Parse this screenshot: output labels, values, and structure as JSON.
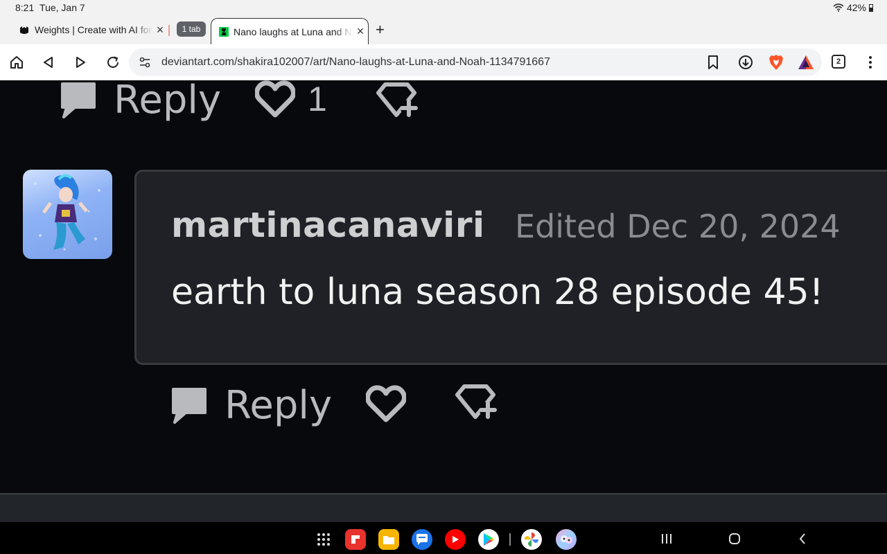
{
  "status_bar": {
    "time": "8:21",
    "date": "Tue, Jan 7",
    "battery": "42%",
    "icons": [
      "wifi-icon",
      "battery-icon"
    ]
  },
  "tabs": {
    "inactive_tab_title": "Weights | Create with AI for F",
    "tab_group_label": "1 tab",
    "active_tab_title": "Nano laughs at Luna and Noah",
    "new_tab_symbol": "+"
  },
  "toolbar": {
    "url": "deviantart.com/shakira102007/art/Nano-laughs-at-Luna-and-Noah-1134791667",
    "tab_count": "2",
    "icons": [
      "home-icon",
      "back-icon",
      "forward-icon",
      "reload-icon",
      "site-settings-icon",
      "bookmark-icon",
      "download-icon",
      "brave-shields-icon",
      "brave-rewards-icon",
      "tabs-icon",
      "menu-icon"
    ]
  },
  "top_comment_actions": {
    "reply_label": "Reply",
    "like_count": "1"
  },
  "comment": {
    "username": "martinacanaviri",
    "edited": "Edited Dec 20, 2024",
    "text": "earth to luna season 28 episode 45!",
    "reply_label": "Reply"
  },
  "dock_apps": [
    "apps-grid-icon",
    "flipboard-icon",
    "files-icon",
    "messages-icon",
    "youtube-icon",
    "play-store-icon",
    "photos-icon",
    "game-icon"
  ],
  "colors": {
    "page_bg": "#08090c",
    "comment_bg": "#202126",
    "action_grey": "#b9babe"
  }
}
